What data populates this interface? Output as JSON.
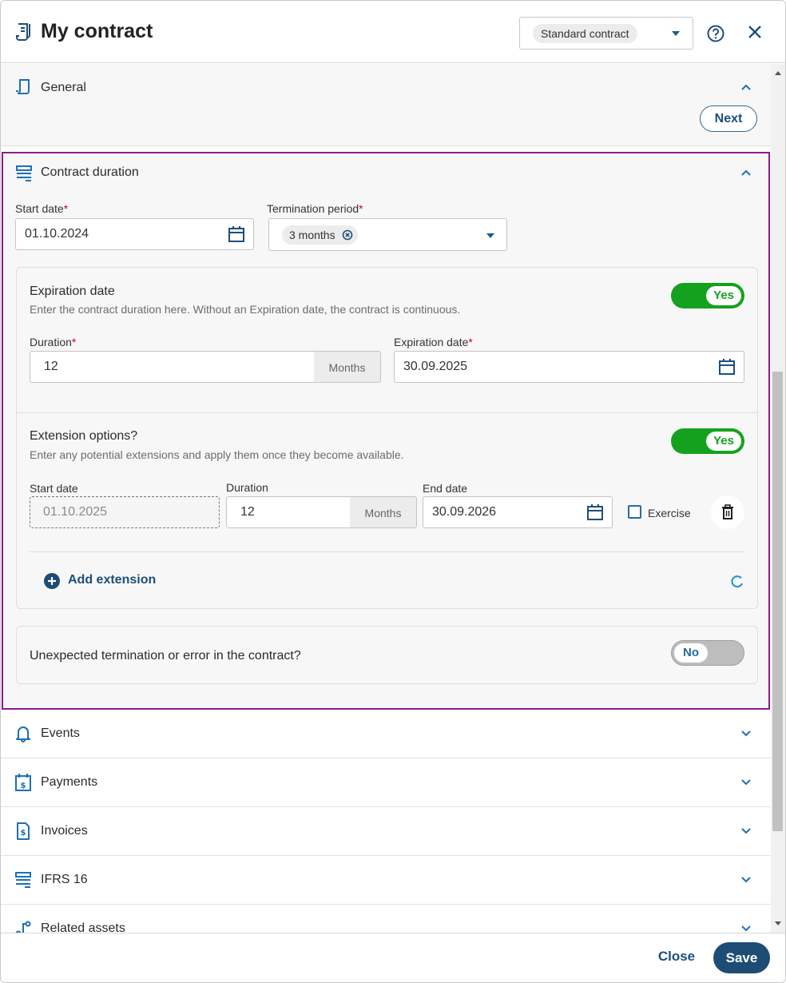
{
  "header": {
    "title": "My contract",
    "contract_type": "Standard contract"
  },
  "colors": {
    "primary": "#1f4e79",
    "accent_blue": "#1c6fb8",
    "toggle_on": "#14a21e",
    "focus_border": "#8a1a8f",
    "required": "#d0021b"
  },
  "sections": {
    "general": {
      "label": "General",
      "next_label": "Next"
    },
    "duration": {
      "label": "Contract duration",
      "start_date_label": "Start date",
      "start_date_value": "01.10.2024",
      "termination_label": "Termination period",
      "termination_value": "3 months",
      "expiration": {
        "title": "Expiration date",
        "subtitle": "Enter the contract duration here. Without an Expiration date, the contract is continuous.",
        "toggle": "Yes",
        "duration_label": "Duration",
        "duration_value": "12",
        "duration_unit": "Months",
        "expiration_label": "Expiration date",
        "expiration_value": "30.09.2025"
      },
      "extension": {
        "title": "Extension options?",
        "subtitle": "Enter any potential extensions and apply them once they become available.",
        "toggle": "Yes",
        "start_label": "Start date",
        "start_value": "01.10.2025",
        "duration_label": "Duration",
        "duration_value": "12",
        "duration_unit": "Months",
        "end_label": "End date",
        "end_value": "30.09.2026",
        "exercise_label": "Exercise",
        "add_label": "Add extension"
      },
      "termination_error": {
        "title": "Unexpected termination or error in the contract?",
        "toggle": "No"
      }
    },
    "events": {
      "label": "Events"
    },
    "payments": {
      "label": "Payments"
    },
    "invoices": {
      "label": "Invoices"
    },
    "ifrs": {
      "label": "IFRS 16"
    },
    "related": {
      "label": "Related assets"
    }
  },
  "footer": {
    "close_label": "Close",
    "save_label": "Save"
  }
}
